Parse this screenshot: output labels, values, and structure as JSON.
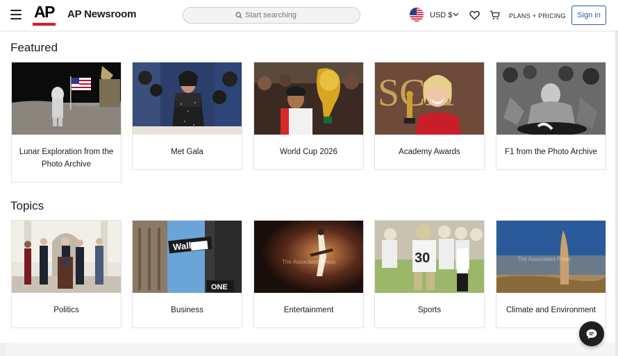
{
  "header": {
    "brand": "AP Newsroom",
    "logo_text": "AP",
    "search_placeholder": "Start searching",
    "currency": "USD $",
    "plans_label": "PLANS + PRICING",
    "signin_label": "Sign in",
    "icons": [
      "menu-icon",
      "search-icon",
      "us-flag-icon",
      "chevron-down-icon",
      "heart-icon",
      "cart-icon"
    ]
  },
  "featured": {
    "title": "Featured",
    "cards": [
      {
        "label": "Lunar Exploration from the Photo Archive"
      },
      {
        "label": "Met Gala"
      },
      {
        "label": "World Cup 2026"
      },
      {
        "label": "Academy Awards"
      },
      {
        "label": "F1 from the Photo Archive"
      }
    ]
  },
  "topics": {
    "title": "Topics",
    "cards": [
      {
        "label": "Politics"
      },
      {
        "label": "Business"
      },
      {
        "label": "Entertainment"
      },
      {
        "label": "Sports"
      },
      {
        "label": "Climate and Environment"
      }
    ]
  },
  "watermark": "The Associated Press",
  "image_text": {
    "wall_sign": "Wall",
    "one_sign": "ONE",
    "jersey_number": "30",
    "oscar_sign": "SCA"
  },
  "colors": {
    "accent_red": "#e3152b",
    "signin_blue": "#2a5aa8"
  },
  "chat_icon": "chat-bubble-icon"
}
